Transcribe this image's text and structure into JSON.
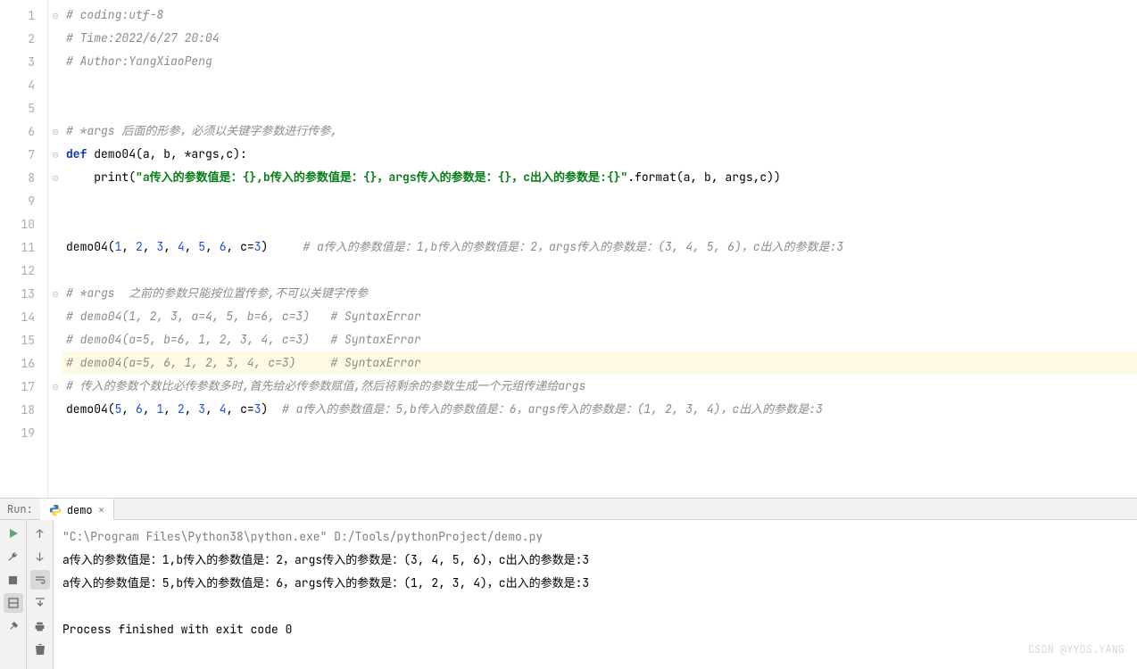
{
  "editor": {
    "lines": [
      {
        "n": 1,
        "fold": "⊟",
        "tokens": [
          [
            "c-comment",
            "# coding:utf-8"
          ]
        ]
      },
      {
        "n": 2,
        "tokens": [
          [
            "c-comment",
            "# Time:2022/6/27 20:04"
          ]
        ]
      },
      {
        "n": 3,
        "tokens": [
          [
            "c-comment",
            "# Author:YangXiaoPeng"
          ]
        ]
      },
      {
        "n": 4,
        "tokens": []
      },
      {
        "n": 5,
        "tokens": []
      },
      {
        "n": 6,
        "fold": "⊟",
        "tokens": [
          [
            "c-comment",
            "# *args 后面的形参，必须以关键字参数进行传参,"
          ]
        ]
      },
      {
        "n": 7,
        "fold": "⊟",
        "tokens": [
          [
            "c-kw",
            "def "
          ],
          [
            "c-fn",
            "demo04"
          ],
          [
            "c-def",
            "(a, b, *args,c):"
          ]
        ]
      },
      {
        "n": 8,
        "fold": "⊟",
        "tokens": [
          [
            "c-def",
            "    "
          ],
          [
            "c-id",
            "print("
          ],
          [
            "c-str",
            "\"a传入的参数值是：{},b传入的参数值是：{}，args传入的参数是：{}，c出入的参数是:{}\""
          ],
          [
            "c-id",
            ".format(a, b, args,c))"
          ]
        ]
      },
      {
        "n": 9,
        "tokens": []
      },
      {
        "n": 10,
        "tokens": []
      },
      {
        "n": 11,
        "tokens": [
          [
            "c-id",
            "demo04("
          ],
          [
            "c-num",
            "1"
          ],
          [
            "c-id",
            ", "
          ],
          [
            "c-num",
            "2"
          ],
          [
            "c-id",
            ", "
          ],
          [
            "c-num",
            "3"
          ],
          [
            "c-id",
            ", "
          ],
          [
            "c-num",
            "4"
          ],
          [
            "c-id",
            ", "
          ],
          [
            "c-num",
            "5"
          ],
          [
            "c-id",
            ", "
          ],
          [
            "c-num",
            "6"
          ],
          [
            "c-id",
            ", c="
          ],
          [
            "c-num",
            "3"
          ],
          [
            "c-id",
            ")     "
          ],
          [
            "c-comment",
            "# a传入的参数值是：1,b传入的参数值是：2，args传入的参数是：(3, 4, 5, 6)，c出入的参数是:3"
          ]
        ]
      },
      {
        "n": 12,
        "tokens": []
      },
      {
        "n": 13,
        "fold": "⊟",
        "tokens": [
          [
            "c-comment",
            "# *args  之前的参数只能按位置传参,不可以关键字传参"
          ]
        ]
      },
      {
        "n": 14,
        "tokens": [
          [
            "c-comment",
            "# demo04(1, 2, 3, a=4, 5, b=6, c=3)   # SyntaxError"
          ]
        ]
      },
      {
        "n": 15,
        "bulb": true,
        "tokens": [
          [
            "c-comment",
            "# demo04(a=5, b=6, 1, 2, 3, 4, c=3)   # SyntaxError"
          ]
        ]
      },
      {
        "n": 16,
        "current": true,
        "tokens": [
          [
            "c-comment",
            "# demo04(a=5, 6, 1, 2, 3, 4, c=3)     # SyntaxError"
          ]
        ]
      },
      {
        "n": 17,
        "fold": "⊟",
        "tokens": [
          [
            "c-comment",
            "# 传入的参数个数比必传参数多时,首先给必传参数赋值,然后将剩余的参数生成一个元组传递给args"
          ]
        ]
      },
      {
        "n": 18,
        "tokens": [
          [
            "c-id",
            "demo04("
          ],
          [
            "c-num",
            "5"
          ],
          [
            "c-id",
            ", "
          ],
          [
            "c-num",
            "6"
          ],
          [
            "c-id",
            ", "
          ],
          [
            "c-num",
            "1"
          ],
          [
            "c-id",
            ", "
          ],
          [
            "c-num",
            "2"
          ],
          [
            "c-id",
            ", "
          ],
          [
            "c-num",
            "3"
          ],
          [
            "c-id",
            ", "
          ],
          [
            "c-num",
            "4"
          ],
          [
            "c-id",
            ", c="
          ],
          [
            "c-num",
            "3"
          ],
          [
            "c-id",
            ")  "
          ],
          [
            "c-comment",
            "# a传入的参数值是：5,b传入的参数值是：6，args传入的参数是：(1, 2, 3, 4)，c出入的参数是:3"
          ]
        ]
      },
      {
        "n": 19,
        "tokens": []
      }
    ]
  },
  "run": {
    "label": "Run:",
    "tab_name": "demo",
    "console_cmd": "\"C:\\Program Files\\Python38\\python.exe\" D:/Tools/pythonProject/demo.py",
    "console_lines": [
      "a传入的参数值是：1,b传入的参数值是：2，args传入的参数是：(3, 4, 5, 6)，c出入的参数是:3",
      "a传入的参数值是：5,b传入的参数值是：6，args传入的参数是：(1, 2, 3, 4)，c出入的参数是:3",
      "",
      "Process finished with exit code 0"
    ]
  },
  "watermark": "CSDN @YYDS.YANG"
}
